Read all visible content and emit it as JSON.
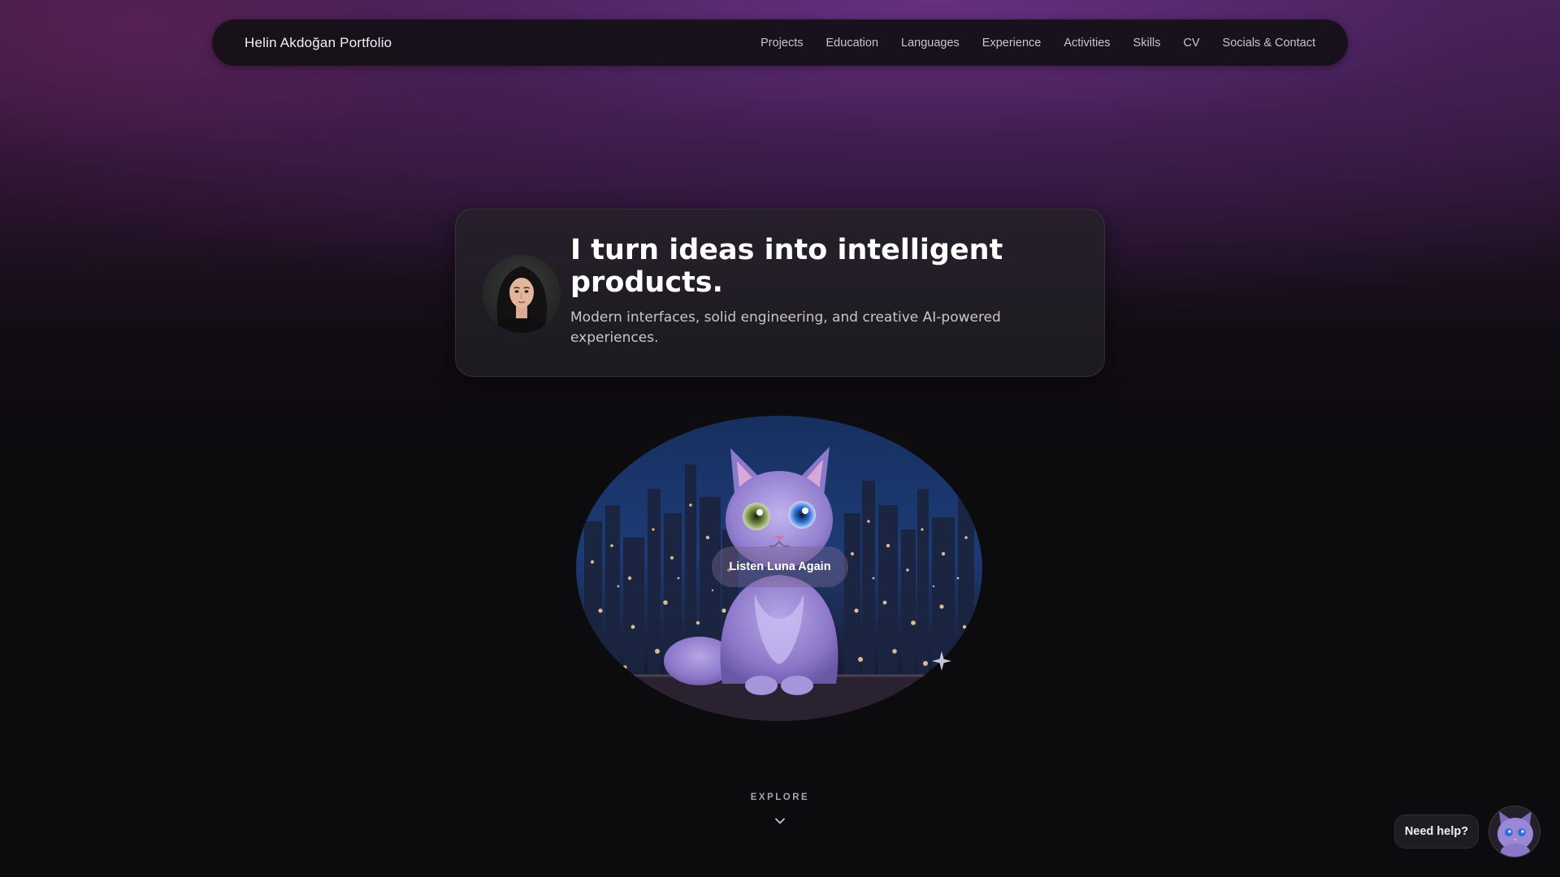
{
  "nav": {
    "brand": "Helin Akdoğan Portfolio",
    "links": [
      "Projects",
      "Education",
      "Languages",
      "Experience",
      "Activities",
      "Skills",
      "CV",
      "Socials & Contact"
    ]
  },
  "hero": {
    "title": "I turn ideas into intelligent products.",
    "subtitle": "Modern interfaces, solid engineering, and creative AI-powered experiences."
  },
  "luna": {
    "button_label": "Listen Luna Again"
  },
  "explore": {
    "label": "EXPLORE"
  },
  "help": {
    "label": "Need help?"
  },
  "colors": {
    "accent_purple": "#8f7bc4",
    "background": "#0c0b0d",
    "header_glow": "#683082"
  },
  "icons": {
    "explore": "chevron-down-icon",
    "sparkle": "sparkle-icon",
    "avatar": "profile-photo",
    "luna": "purple-cat-illustration"
  }
}
